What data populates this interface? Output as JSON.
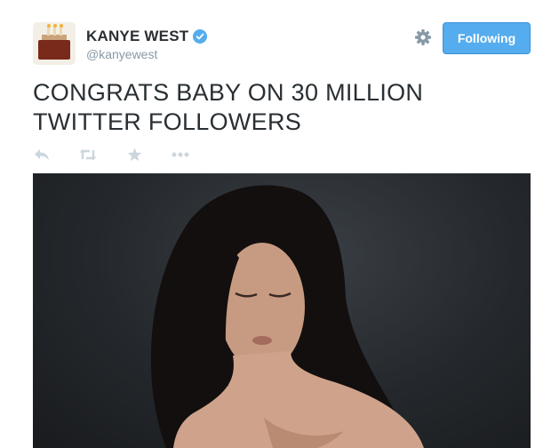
{
  "user": {
    "display_name": "KANYE WEST",
    "handle": "@kanyewest",
    "verified": true
  },
  "follow_button": {
    "label": "Following"
  },
  "tweet": {
    "text": "CONGRATS BABY ON 30 MILLION TWITTER FOLLOWERS"
  },
  "actions": [
    {
      "icon": "reply-icon"
    },
    {
      "icon": "retweet-icon"
    },
    {
      "icon": "favorite-star-icon"
    },
    {
      "icon": "more-options-icon"
    }
  ],
  "colors": {
    "accent": "#55acee",
    "text": "#292f33",
    "muted": "#8899a6",
    "action_icons": "#ccd6dd"
  }
}
